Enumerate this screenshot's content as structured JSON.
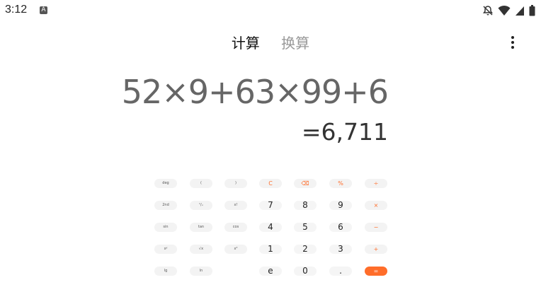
{
  "status_bar": {
    "time": "3:12",
    "notification_icon": "a-icon",
    "icons": [
      "bell-off-icon",
      "wifi-icon",
      "signal-icon",
      "battery-icon"
    ]
  },
  "tabs": [
    {
      "label": "计算",
      "active": true
    },
    {
      "label": "换算",
      "active": false
    }
  ],
  "menu_icon": "more-vert-icon",
  "display": {
    "expression": "52×9+63×99+6",
    "result": "=6,711"
  },
  "keypad": {
    "rows": [
      [
        "deg",
        "(",
        ")",
        "C",
        "⌫",
        "%",
        "÷"
      ],
      [
        "2nd",
        "¹/ₓ",
        "x!",
        "7",
        "8",
        "9",
        "×"
      ],
      [
        "sin",
        "tan",
        "cos",
        "4",
        "5",
        "6",
        "−"
      ],
      [
        "xʸ",
        "√x",
        "x²",
        "1",
        "2",
        "3",
        "+"
      ],
      [
        "lg",
        "ln",
        "",
        "e",
        "0",
        ".",
        "="
      ]
    ]
  },
  "colors": {
    "accent": "#ff6d2a",
    "key_bg": "#f3f3f3",
    "expression_text": "#666666",
    "result_text": "#333333"
  }
}
